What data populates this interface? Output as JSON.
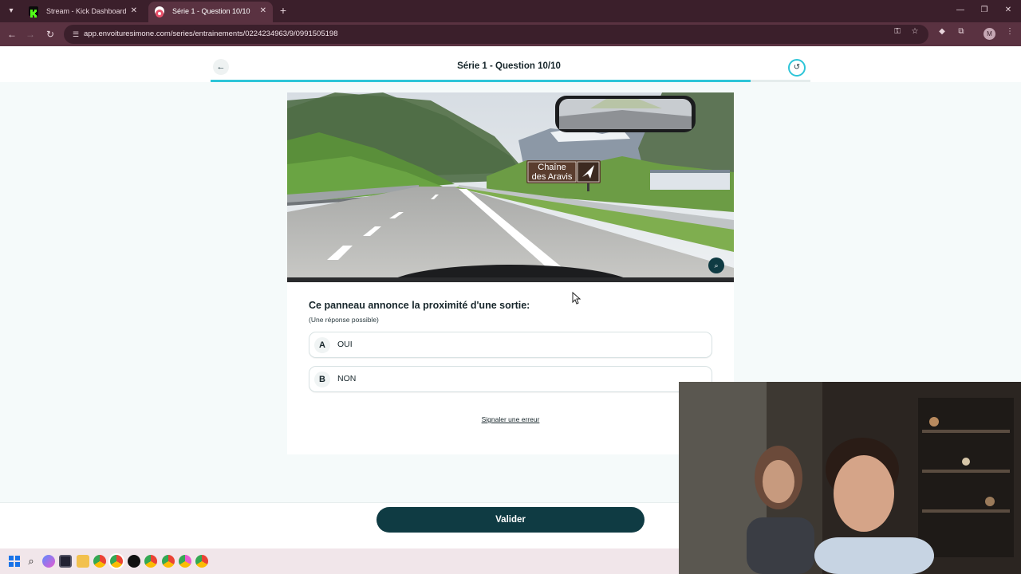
{
  "browser": {
    "tabs": [
      {
        "title": "Stream - Kick Dashboard",
        "favicon_color": "#53fc18",
        "active": false
      },
      {
        "title": "Série 1 - Question 10/10",
        "favicon_color": "#e8506a",
        "active": true
      }
    ],
    "url": "app.envoituresimone.com/series/entrainements/0224234963/9/0991505198",
    "profile_initial": "M",
    "theme_colors": {
      "tabbar": "#3b1f2b",
      "toolbar": "#5a3241"
    }
  },
  "page": {
    "title": "Série 1 - Question 10/10",
    "progress": 0.9,
    "accent_color": "#2ec5d8",
    "brand_color": "#0f3b43"
  },
  "scene": {
    "sign_line1": "Chaîne",
    "sign_line2": "des Aravis"
  },
  "question": {
    "text": "Ce panneau annonce la proximité d'une sortie:",
    "hint": "(Une réponse possible)",
    "answers": [
      {
        "letter": "A",
        "label": "OUI"
      },
      {
        "letter": "B",
        "label": "NON"
      }
    ]
  },
  "report_link": "Signaler une erreur",
  "validate_label": "Valider"
}
